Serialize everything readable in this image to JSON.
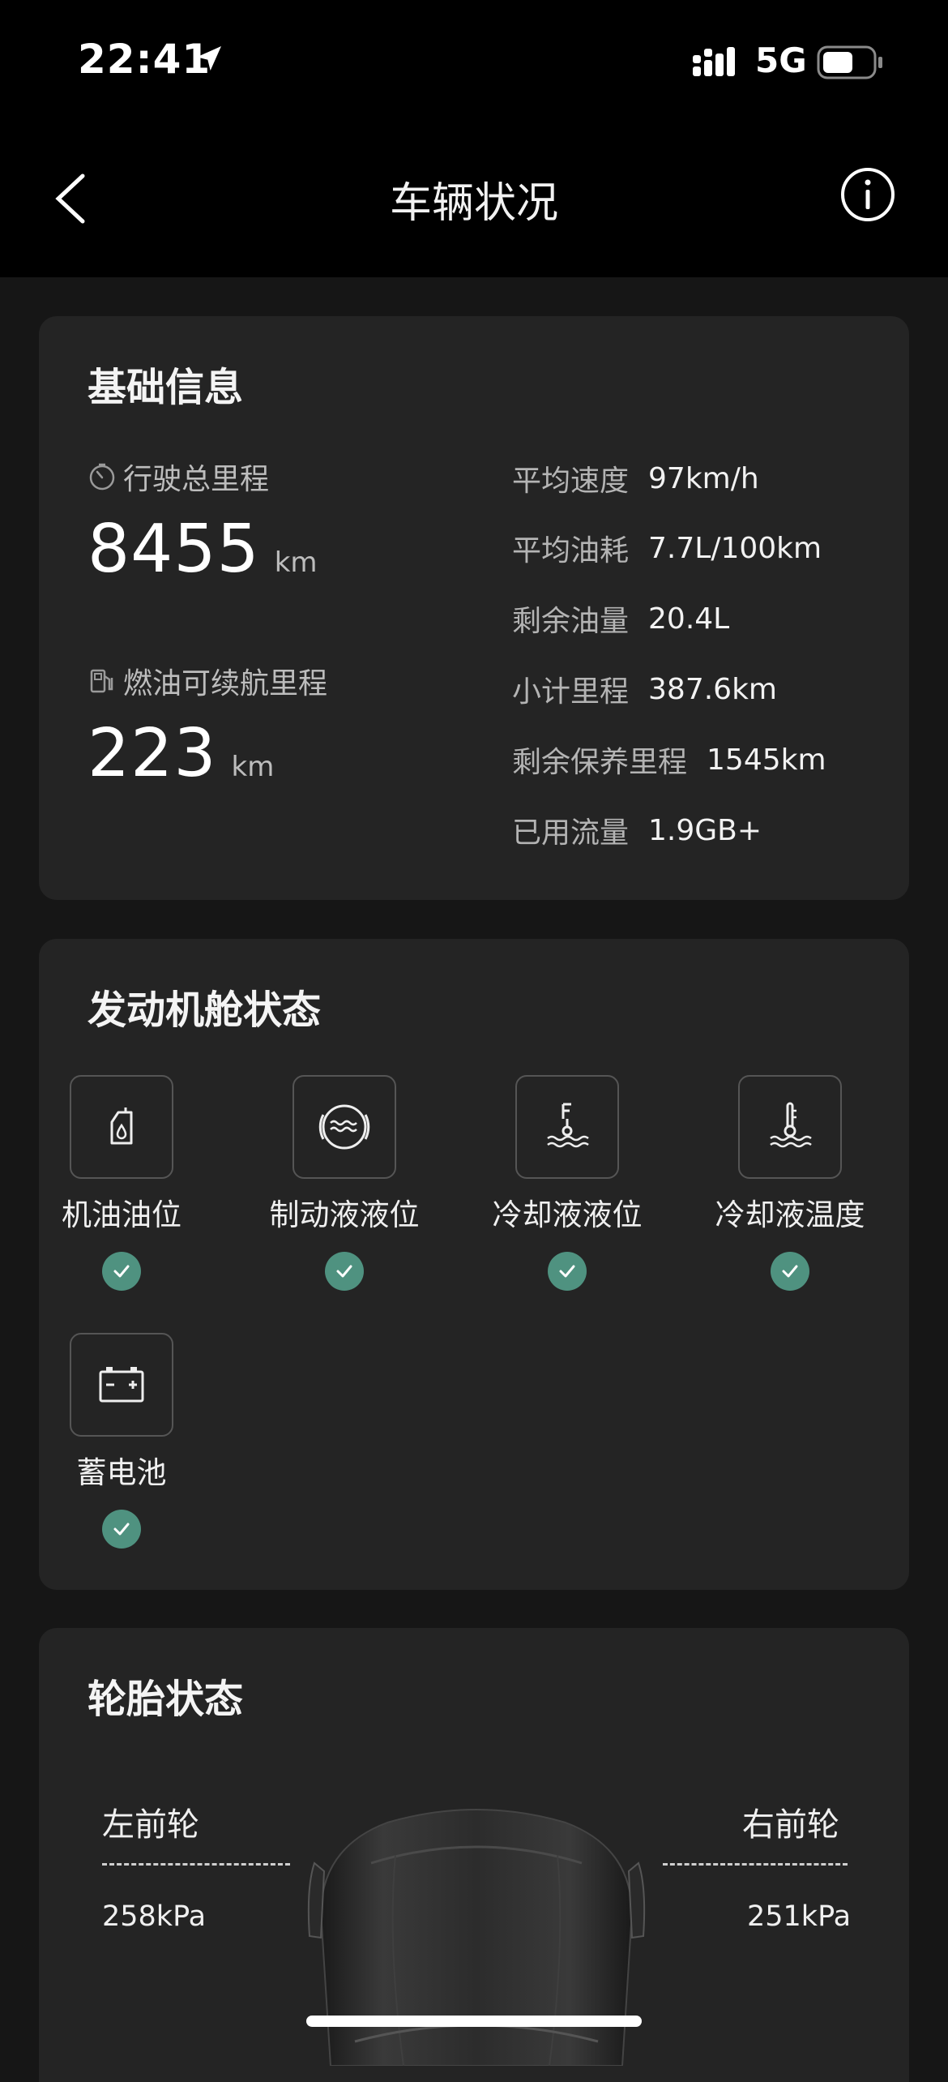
{
  "status_bar": {
    "time": "22:41",
    "network": "5G",
    "icons": [
      "location-arrow-icon",
      "signal-icon",
      "battery-icon"
    ]
  },
  "nav": {
    "title": "车辆状况",
    "icons": [
      "back-chevron-icon",
      "info-icon"
    ]
  },
  "basic_info": {
    "title": "基础信息",
    "total_mileage": {
      "label": "行驶总里程",
      "value": "8455",
      "unit": "km",
      "icon": "timer-icon"
    },
    "fuel_range": {
      "label": "燃油可续航里程",
      "value": "223",
      "unit": "km",
      "icon": "fuel-pump-icon"
    },
    "stats": [
      {
        "label": "平均速度",
        "value": "97km/h"
      },
      {
        "label": "平均油耗",
        "value": "7.7L/100km"
      },
      {
        "label": "剩余油量",
        "value": "20.4L"
      },
      {
        "label": "小计里程",
        "value": "387.6km"
      },
      {
        "label": "剩余保养里程",
        "value": "1545km"
      },
      {
        "label": "已用流量",
        "value": "1.9GB+"
      }
    ]
  },
  "engine": {
    "title": "发动机舱状态",
    "items": [
      {
        "label": "机油油位",
        "icon": "oil-can-icon",
        "status": "ok"
      },
      {
        "label": "制动液液位",
        "icon": "brake-fluid-icon",
        "status": "ok"
      },
      {
        "label": "冷却液液位",
        "icon": "coolant-level-icon",
        "status": "ok"
      },
      {
        "label": "冷却液温度",
        "icon": "coolant-temperature-icon",
        "status": "ok"
      },
      {
        "label": "蓄电池",
        "icon": "battery-12v-icon",
        "status": "ok"
      }
    ]
  },
  "tires": {
    "title": "轮胎状态",
    "front_left": {
      "label": "左前轮",
      "pressure": "258kPa"
    },
    "front_right": {
      "label": "右前轮",
      "pressure": "251kPa"
    }
  },
  "colors": {
    "background": "#161616",
    "card": "#242424",
    "ok_green": "#4f9280"
  }
}
